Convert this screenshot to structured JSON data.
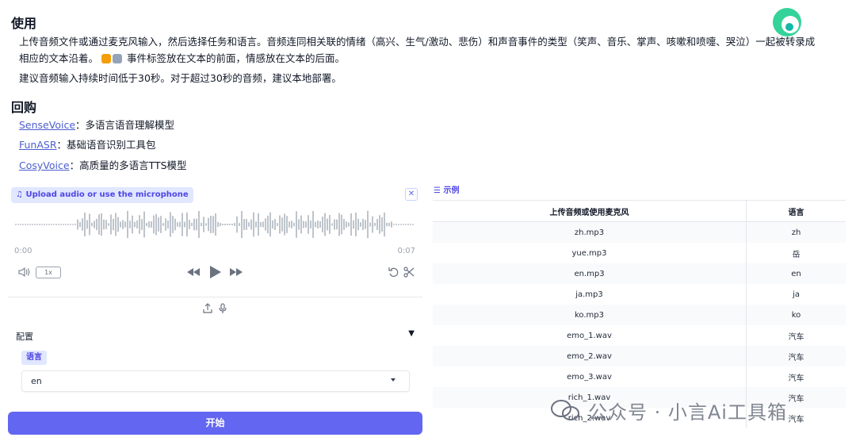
{
  "usage": {
    "heading": "使用",
    "para1_line1": "上传音频文件或通过麦克风输入，然后选择任务和语言。音频连同相关联的情绪（高兴、生气/激动、悲伤）和声音事件的类型（笑声、音乐、掌声、咳嗽和喷嚏、哭泣）一起被转录成",
    "para1_line2": "相应的文本沿着。",
    "para1_line2b": "事件标签放在文本的前面，情感放在文本的后面。",
    "para2": "建议音频输入持续时间低于30秒。对于超过30秒的音频，建议本地部署。"
  },
  "repo": {
    "heading": "回购",
    "links": [
      {
        "name": "SenseVoice",
        "desc": "：多语言语音理解模型"
      },
      {
        "name": "FunASR",
        "desc": "：基础语音识别工具包"
      },
      {
        "name": "CosyVoice",
        "desc": "：高质量的多语言TTS模型"
      }
    ]
  },
  "audio": {
    "label": "Upload audio or use the microphone",
    "time_start": "0:00",
    "time_end": "0:07",
    "speed": "1x",
    "close_icon": "x-icon",
    "volume_icon": "volume-icon",
    "rewind_icon": "rewind-icon",
    "play_icon": "play-icon",
    "forward_icon": "fast-forward-icon",
    "undo_icon": "undo-icon",
    "trim_icon": "scissors-icon",
    "upload_icon": "upload-icon",
    "mic_icon": "microphone-icon"
  },
  "config": {
    "title": "配置",
    "lang_label": "语言",
    "lang_value": "en"
  },
  "start_button": "开始",
  "examples": {
    "title": "示例",
    "columns": [
      "上传音频或使用麦克风",
      "语言"
    ],
    "rows": [
      [
        "zh.mp3",
        "zh"
      ],
      [
        "yue.mp3",
        "岳"
      ],
      [
        "en.mp3",
        "en"
      ],
      [
        "ja.mp3",
        "ja"
      ],
      [
        "ko.mp3",
        "ko"
      ],
      [
        "emo_1.wav",
        "汽车"
      ],
      [
        "emo_2.wav",
        "汽车"
      ],
      [
        "emo_3.wav",
        "汽车"
      ],
      [
        "rich_1.wav",
        "汽车"
      ],
      [
        "rich_2.wav",
        "汽车"
      ]
    ]
  },
  "watermark": "公众号 · 小言Ai工具箱",
  "colors": {
    "accent": "#6366f1",
    "label_bg": "#e0e7ff",
    "link": "#4b5ecf"
  }
}
